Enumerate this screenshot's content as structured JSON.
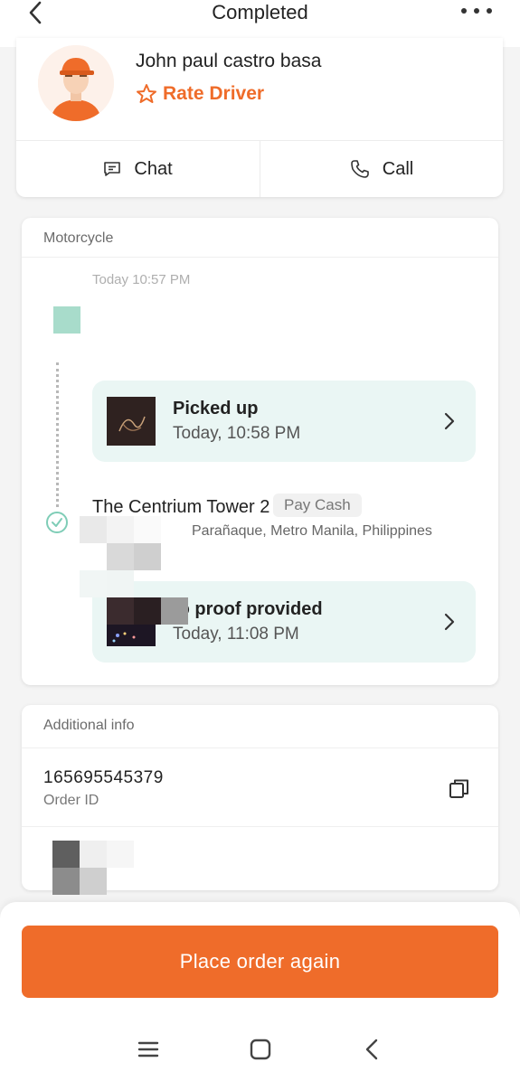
{
  "header": {
    "title": "Completed",
    "back_icon": "chevron-left-icon",
    "more_icon": "more-dots-icon"
  },
  "driver": {
    "name": "John paul castro basa",
    "rate_label": "Rate Driver",
    "chat_label": "Chat",
    "call_label": "Call"
  },
  "route": {
    "section_label": "Motorcycle",
    "pickup_time_faded": "Today 10:57 PM",
    "picked_up": {
      "title": "Picked up",
      "time": "Today, 10:58 PM"
    },
    "dropoff": {
      "name": "The Centrium Tower 2",
      "payment_badge": "Pay Cash",
      "address_visible": "Parañaque, Metro Manila, Philippines"
    },
    "delivered": {
      "title": "to proof provided",
      "time": "Today, 11:08 PM"
    }
  },
  "additional_info": {
    "section_label": "Additional info",
    "order_id": "165695545379",
    "order_id_label": "Order ID"
  },
  "footer": {
    "place_again_label": "Place order again"
  },
  "colors": {
    "accent": "#ef6c2a",
    "status_bg": "#eaf6f4",
    "teal": "#7fcdb7"
  }
}
